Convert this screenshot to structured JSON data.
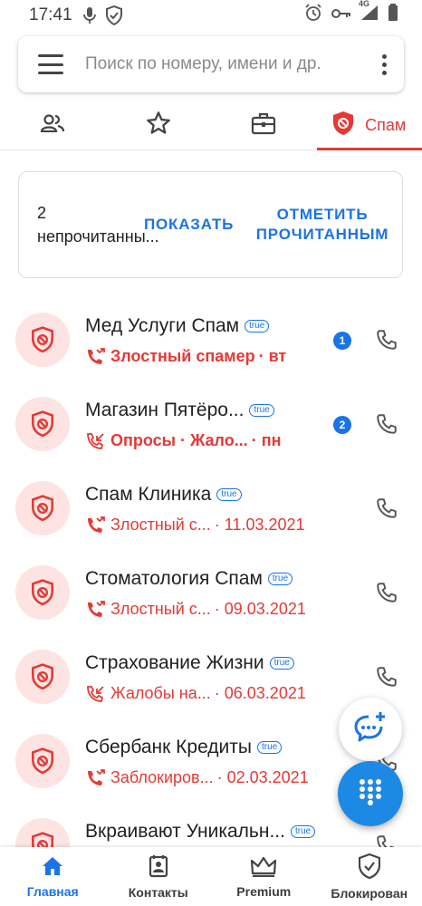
{
  "status_bar": {
    "time": "17:41",
    "network": "4G"
  },
  "search": {
    "placeholder": "Поиск по номеру, имени и др."
  },
  "tabs": [
    {
      "icon": "people-icon",
      "label": ""
    },
    {
      "icon": "star-icon",
      "label": ""
    },
    {
      "icon": "briefcase-icon",
      "label": ""
    },
    {
      "icon": "spam-shield-icon",
      "label": "Спам",
      "active": true
    }
  ],
  "unread_card": {
    "text": "2 непрочитанны...",
    "show_label": "ПОКАЗАТЬ",
    "mark_label": "ОТМЕТИТЬ ПРОЧИТАННЫМ"
  },
  "calls": [
    {
      "name": "Мед Услуги Спам",
      "badge": "true",
      "type_icon": "missed-call-icon",
      "sub": "Злостный спамер",
      "date": "· вт",
      "unread": "1",
      "bold": true
    },
    {
      "name": "Магазин Пятёро...",
      "badge": "true",
      "type_icon": "incoming-call-icon",
      "sub": "Опросы · Жало...",
      "date": "· пн",
      "unread": "2",
      "bold": true
    },
    {
      "name": "Спам Клиника",
      "badge": "true",
      "type_icon": "missed-call-icon",
      "sub": "Злостный с...",
      "date": "· 11.03.2021",
      "unread": "",
      "bold": false
    },
    {
      "name": "Стоматология Спам",
      "badge": "true",
      "type_icon": "missed-call-icon",
      "sub": "Злостный с...",
      "date": "· 09.03.2021",
      "unread": "",
      "bold": false
    },
    {
      "name": "Страхование Жизни",
      "badge": "true",
      "type_icon": "incoming-call-icon",
      "sub": "Жалобы на...",
      "date": "· 06.03.2021",
      "unread": "",
      "bold": false
    },
    {
      "name": "Сбербанк Кредиты",
      "badge": "true",
      "type_icon": "missed-call-icon",
      "sub": "Заблокиров...",
      "date": "· 02.03.2021",
      "unread": "",
      "bold": false
    },
    {
      "name": "Вкраивают Уникальн...",
      "badge": "true",
      "type_icon": "missed-call-icon",
      "sub": "",
      "date": "",
      "unread": "",
      "bold": false
    }
  ],
  "bottom_nav": [
    {
      "icon": "home-icon",
      "label": "Главная",
      "active": true
    },
    {
      "icon": "contacts-icon",
      "label": "Контакты"
    },
    {
      "icon": "crown-icon",
      "label": "Premium"
    },
    {
      "icon": "blocked-shield-icon",
      "label": "Блокирован"
    }
  ],
  "colors": {
    "accent": "#1a73e8",
    "spam": "#e53935",
    "spam_bg": "#fde4e2"
  }
}
